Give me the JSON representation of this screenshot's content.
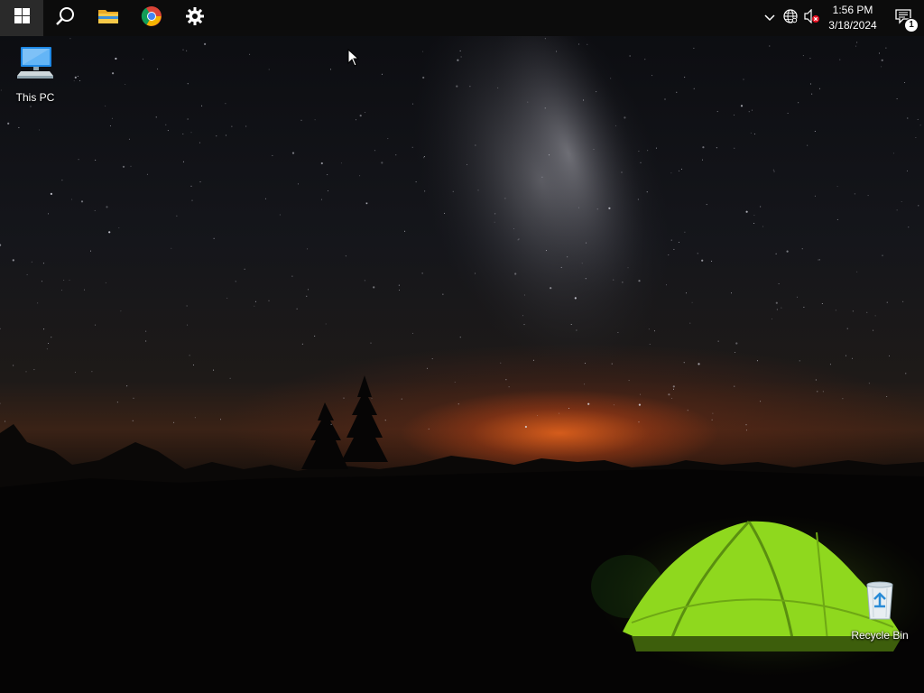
{
  "taskbar": {
    "start": {
      "icon": "windows-logo-icon"
    },
    "search": {
      "icon": "search-icon"
    },
    "pinned": [
      {
        "name": "file-explorer",
        "icon": "folder-icon"
      },
      {
        "name": "chrome",
        "icon": "chrome-icon"
      },
      {
        "name": "settings",
        "icon": "gear-icon"
      }
    ],
    "tray": {
      "chevron_icon": "chevron-up-icon",
      "network_icon": "globe-network-icon",
      "volume_icon": "speaker-muted-icon",
      "time": "1:56 PM",
      "date": "3/18/2024",
      "notification_count": "1"
    }
  },
  "desktop": {
    "icons": [
      {
        "label": "This PC",
        "icon": "computer-icon"
      },
      {
        "label": "Recycle Bin",
        "icon": "recycle-bin-icon"
      }
    ]
  },
  "colors": {
    "taskbar_bg": "#0c0c0c",
    "windows_accent": "#ffffff",
    "sky_glow": "#ff6e1e",
    "tent_green": "#8fd81e"
  }
}
